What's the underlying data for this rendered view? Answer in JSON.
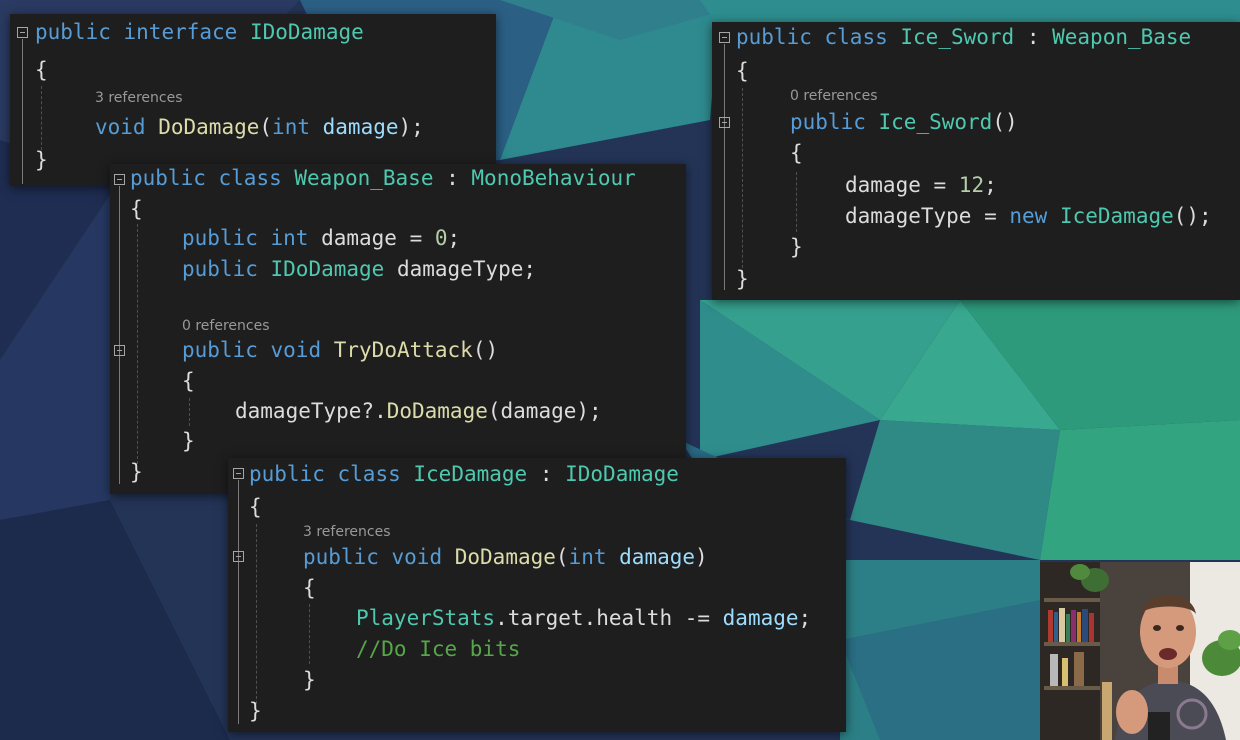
{
  "panels": {
    "idodamage": {
      "refs": [
        "3 references"
      ],
      "lines": [
        [
          [
            "public",
            "kw"
          ],
          [
            " ",
            "pn"
          ],
          [
            "interface",
            "kw"
          ],
          [
            " ",
            "pn"
          ],
          [
            "IDoDamage",
            "ty"
          ]
        ],
        [
          [
            "{",
            "pn"
          ]
        ],
        [
          [
            "void",
            "kw"
          ],
          [
            " ",
            "pn"
          ],
          [
            "DoDamage",
            "fn"
          ],
          [
            "(",
            "pn"
          ],
          [
            "int",
            "kw"
          ],
          [
            " ",
            "pn"
          ],
          [
            "damage",
            "pr"
          ],
          [
            ");",
            "pn"
          ]
        ],
        [
          [
            "}",
            "pn"
          ]
        ]
      ]
    },
    "weaponbase": {
      "refs": [
        "0 references"
      ],
      "lines": [
        [
          [
            "public",
            "kw"
          ],
          [
            " ",
            "pn"
          ],
          [
            "class",
            "kw"
          ],
          [
            " ",
            "pn"
          ],
          [
            "Weapon_Base",
            "ty"
          ],
          [
            " : ",
            "pn"
          ],
          [
            "MonoBehaviour",
            "ty"
          ]
        ],
        [
          [
            "{",
            "pn"
          ]
        ],
        [
          [
            "public",
            "kw"
          ],
          [
            " ",
            "pn"
          ],
          [
            "int",
            "kw"
          ],
          [
            " damage = ",
            "id"
          ],
          [
            "0",
            "nm"
          ],
          [
            ";",
            "pn"
          ]
        ],
        [
          [
            "public",
            "kw"
          ],
          [
            " ",
            "pn"
          ],
          [
            "IDoDamage",
            "ty"
          ],
          [
            " damageType;",
            "id"
          ]
        ],
        [
          [
            "public",
            "kw"
          ],
          [
            " ",
            "pn"
          ],
          [
            "void",
            "kw"
          ],
          [
            " ",
            "pn"
          ],
          [
            "TryDoAttack",
            "fn"
          ],
          [
            "()",
            "pn"
          ]
        ],
        [
          [
            "{",
            "pn"
          ]
        ],
        [
          [
            "damageType?.",
            "id"
          ],
          [
            "DoDamage",
            "fn"
          ],
          [
            "(damage);",
            "id"
          ]
        ],
        [
          [
            "}",
            "pn"
          ]
        ],
        [
          [
            "}",
            "pn"
          ]
        ]
      ]
    },
    "icedamage": {
      "refs": [
        "3 references"
      ],
      "lines": [
        [
          [
            "public",
            "kw"
          ],
          [
            " ",
            "pn"
          ],
          [
            "class",
            "kw"
          ],
          [
            " ",
            "pn"
          ],
          [
            "IceDamage",
            "ty"
          ],
          [
            " : ",
            "pn"
          ],
          [
            "IDoDamage",
            "ty"
          ]
        ],
        [
          [
            "{",
            "pn"
          ]
        ],
        [
          [
            "public",
            "kw"
          ],
          [
            " ",
            "pn"
          ],
          [
            "void",
            "kw"
          ],
          [
            " ",
            "pn"
          ],
          [
            "DoDamage",
            "fn"
          ],
          [
            "(",
            "pn"
          ],
          [
            "int",
            "kw"
          ],
          [
            " ",
            "pn"
          ],
          [
            "damage",
            "pr"
          ],
          [
            ")",
            "pn"
          ]
        ],
        [
          [
            "{",
            "pn"
          ]
        ],
        [
          [
            "PlayerStats",
            "ty"
          ],
          [
            ".target.health -= ",
            "id"
          ],
          [
            "damage",
            "pr"
          ],
          [
            ";",
            "pn"
          ]
        ],
        [
          [
            "//Do Ice bits",
            "cm"
          ]
        ],
        [
          [
            "}",
            "pn"
          ]
        ],
        [
          [
            "}",
            "pn"
          ]
        ]
      ]
    },
    "icesword": {
      "refs": [
        "0 references"
      ],
      "lines": [
        [
          [
            "public",
            "kw"
          ],
          [
            " ",
            "pn"
          ],
          [
            "class",
            "kw"
          ],
          [
            " ",
            "pn"
          ],
          [
            "Ice_Sword",
            "ty"
          ],
          [
            " : ",
            "pn"
          ],
          [
            "Weapon_Base",
            "ty"
          ]
        ],
        [
          [
            "{",
            "pn"
          ]
        ],
        [
          [
            "public",
            "kw"
          ],
          [
            " ",
            "pn"
          ],
          [
            "Ice_Sword",
            "ty"
          ],
          [
            "()",
            "pn"
          ]
        ],
        [
          [
            "{",
            "pn"
          ]
        ],
        [
          [
            "damage = ",
            "id"
          ],
          [
            "12",
            "nm"
          ],
          [
            ";",
            "pn"
          ]
        ],
        [
          [
            "damageType = ",
            "id"
          ],
          [
            "new",
            "kw"
          ],
          [
            " ",
            "pn"
          ],
          [
            "IceDamage",
            "ty"
          ],
          [
            "();",
            "pn"
          ]
        ],
        [
          [
            "}",
            "pn"
          ]
        ],
        [
          [
            "}",
            "pn"
          ]
        ]
      ]
    }
  },
  "colors": {
    "keyword": "#569cd6",
    "type": "#4ec9b0",
    "method": "#dcdcaa",
    "parameter": "#9cdcfe",
    "number": "#b5cea8",
    "comment": "#57a64a",
    "text": "#dcdcdc",
    "panel_bg": "#1e1e1e"
  },
  "icons": {
    "fold": "collapse-minus-icon"
  }
}
